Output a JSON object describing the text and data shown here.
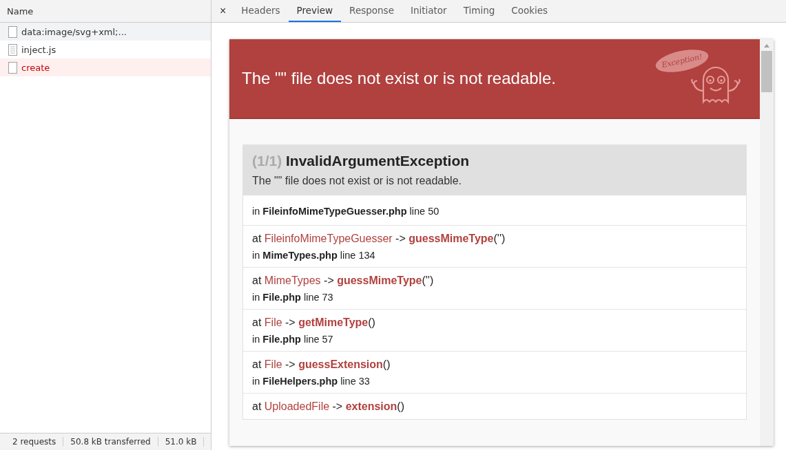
{
  "requests": {
    "header": "Name",
    "items": [
      {
        "name": "data:image/svg+xml;...",
        "kind": "blank",
        "selected": true,
        "error": false
      },
      {
        "name": "inject.js",
        "kind": "script",
        "selected": false,
        "error": false
      },
      {
        "name": "create",
        "kind": "blank",
        "selected": false,
        "error": true
      }
    ],
    "status_bar": [
      "2 requests",
      "50.8 kB transferred",
      "51.0 kB"
    ]
  },
  "close": "×",
  "tabs": [
    {
      "label": "Headers",
      "selected": false
    },
    {
      "label": "Preview",
      "selected": true
    },
    {
      "label": "Response",
      "selected": false
    },
    {
      "label": "Initiator",
      "selected": false
    },
    {
      "label": "Timing",
      "selected": false
    },
    {
      "label": "Cookies",
      "selected": false
    }
  ],
  "preview": {
    "title": "The \"\" file does not exist or is not readable.",
    "badge": "Exception!",
    "exception": {
      "count": "(1/1)",
      "class": "InvalidArgumentException",
      "message": "The \"\" file does not exist or is not readable."
    },
    "frames": [
      {
        "location": {
          "prefix": "in",
          "file": "FileinfoMimeTypeGuesser.php",
          "line": "line 50"
        }
      },
      {
        "call": {
          "prefix": "at",
          "class": "FileinfoMimeTypeGuesser",
          "arrow": "->",
          "function": "guessMimeType",
          "args": "('')"
        },
        "location": {
          "prefix": "in",
          "file": "MimeTypes.php",
          "line": "line 134"
        }
      },
      {
        "call": {
          "prefix": "at",
          "class": "MimeTypes",
          "arrow": "->",
          "function": "guessMimeType",
          "args": "('')"
        },
        "location": {
          "prefix": "in",
          "file": "File.php",
          "line": "line 73"
        }
      },
      {
        "call": {
          "prefix": "at",
          "class": "File",
          "arrow": "->",
          "function": "getMimeType",
          "args": "()"
        },
        "location": {
          "prefix": "in",
          "file": "File.php",
          "line": "line 57"
        }
      },
      {
        "call": {
          "prefix": "at",
          "class": "File",
          "arrow": "->",
          "function": "guessExtension",
          "args": "()"
        },
        "location": {
          "prefix": "in",
          "file": "FileHelpers.php",
          "line": "line 33"
        }
      },
      {
        "call": {
          "prefix": "at",
          "class": "UploadedFile",
          "arrow": "->",
          "function": "extension",
          "args": "()"
        }
      }
    ]
  }
}
